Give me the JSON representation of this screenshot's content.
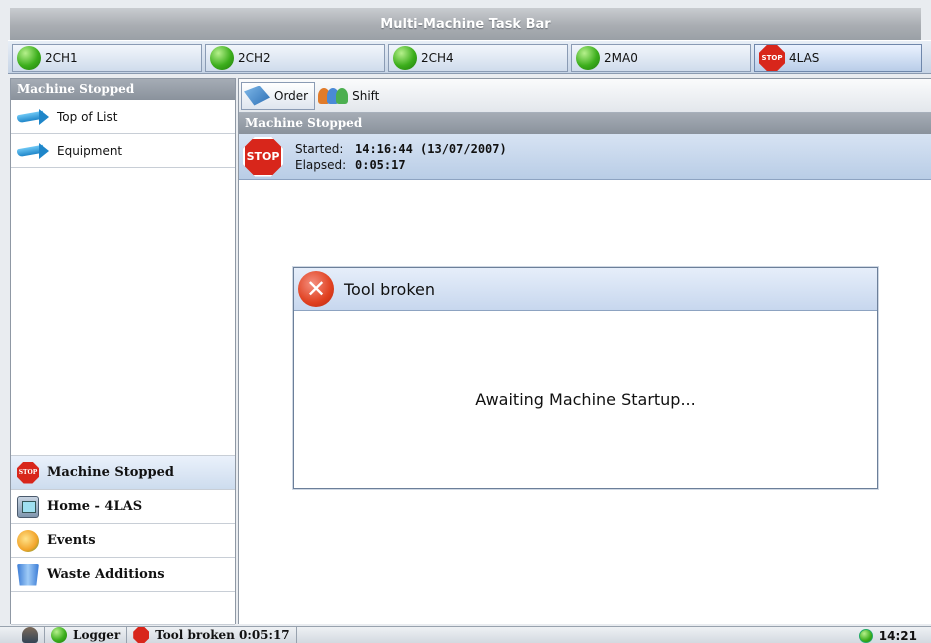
{
  "window": {
    "title": "Multi-Machine Task Bar"
  },
  "machines": [
    {
      "name": "2CH1",
      "status": "running"
    },
    {
      "name": "2CH2",
      "status": "running"
    },
    {
      "name": "2CH4",
      "status": "running"
    },
    {
      "name": "2MA0",
      "status": "running"
    },
    {
      "name": "4LAS",
      "status": "stopped",
      "icon_text": "STOP"
    }
  ],
  "left_panel": {
    "header": "Machine Stopped",
    "items": [
      {
        "label": "Top of List",
        "icon": "arrow-icon"
      },
      {
        "label": "Equipment",
        "icon": "arrow-icon"
      }
    ],
    "bottom_items": [
      {
        "label": "Machine Stopped",
        "icon": "stop-icon",
        "icon_text": "STOP"
      },
      {
        "label": "Home - 4LAS",
        "icon": "home-icon"
      },
      {
        "label": "Events",
        "icon": "events-icon"
      },
      {
        "label": "Waste Additions",
        "icon": "bin-icon"
      }
    ]
  },
  "toolbar": {
    "order_label": "Order",
    "shift_label": "Shift"
  },
  "main": {
    "header": "Machine Stopped",
    "stop_icon_text": "STOP",
    "started_label": "Started:",
    "started_value": "14:16:44 (13/07/2007)",
    "elapsed_label": "Elapsed:",
    "elapsed_value": "0:05:17"
  },
  "dialog": {
    "title": "Tool broken",
    "message": "Awaiting Machine Startup...",
    "icon_text": "✕"
  },
  "statusbar": {
    "logger_label": "Logger",
    "event_label": "Tool broken 0:05:17",
    "time": "14:21"
  },
  "colors": {
    "stop_red": "#d8261b",
    "running_green": "#3cae1c",
    "header_gray": "#8a929c",
    "accent_blue": "#b9cde6"
  }
}
